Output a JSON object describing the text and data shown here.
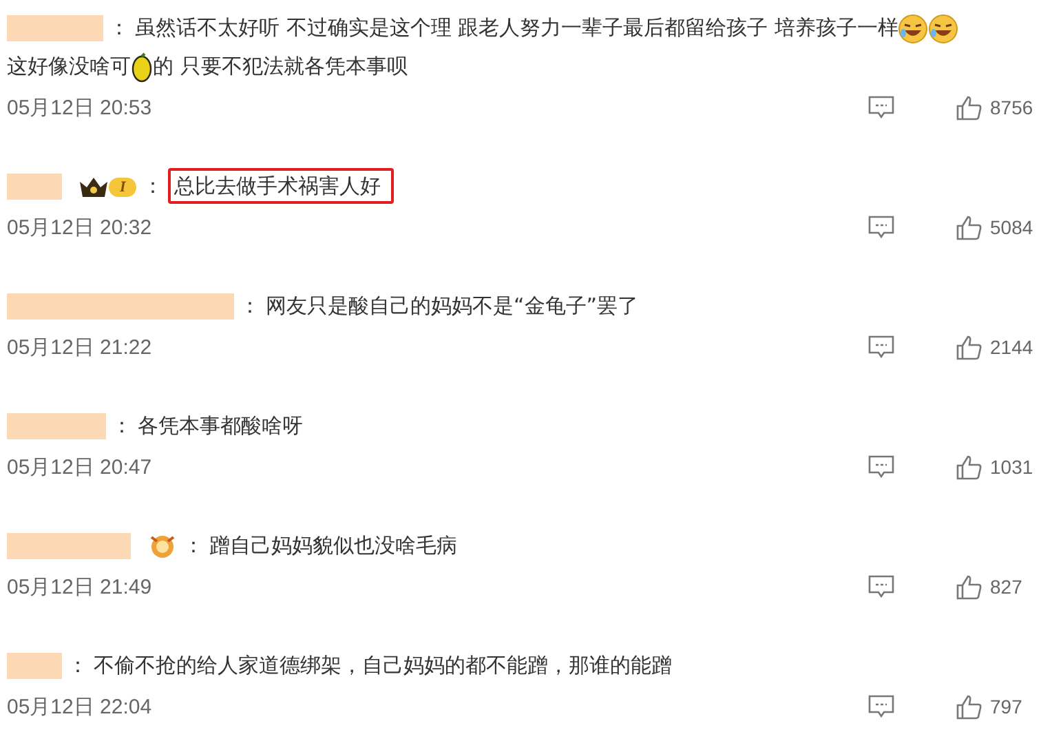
{
  "comments": [
    {
      "colon": "：",
      "segments": [
        {
          "kind": "text",
          "text": "虽然话不太好听 不过确实是这个理 跟老人努力一辈子最后都留给孩子 培养孩子一样"
        },
        {
          "kind": "laugh"
        },
        {
          "kind": "laugh"
        },
        {
          "kind": "text",
          "text": "这好像没啥可"
        },
        {
          "kind": "lemon"
        },
        {
          "kind": "text",
          "text": "的 只要不犯法就各凭本事呗"
        }
      ],
      "highlighted": false,
      "time": "05月12日 20:53",
      "likes": "8756"
    },
    {
      "badge": {
        "kind": "crown",
        "text": "I"
      },
      "colon": "：",
      "segments": [
        {
          "kind": "text",
          "text": "总比去做手术祸害人好"
        }
      ],
      "highlighted": true,
      "time": "05月12日 20:32",
      "likes": "5084"
    },
    {
      "colon": "：",
      "segments": [
        {
          "kind": "text",
          "text": "网友只是酸自己的妈妈不是“金龟子”罢了"
        }
      ],
      "highlighted": false,
      "time": "05月12日 21:22",
      "likes": "2144"
    },
    {
      "colon": "：",
      "segments": [
        {
          "kind": "text",
          "text": "各凭本事都酸啥呀"
        }
      ],
      "highlighted": false,
      "time": "05月12日 20:47",
      "likes": "1031"
    },
    {
      "badge": {
        "kind": "medal"
      },
      "colon": "：",
      "segments": [
        {
          "kind": "text",
          "text": "蹭自己妈妈貌似也没啥毛病"
        }
      ],
      "highlighted": false,
      "time": "05月12日 21:49",
      "likes": "827"
    },
    {
      "colon": "：",
      "segments": [
        {
          "kind": "text",
          "text": "不偷不抢的给人家道德绑架，自己妈妈的都不能蹭，那谁的能蹭"
        }
      ],
      "highlighted": false,
      "time": "05月12日 22:04",
      "likes": "797"
    }
  ]
}
